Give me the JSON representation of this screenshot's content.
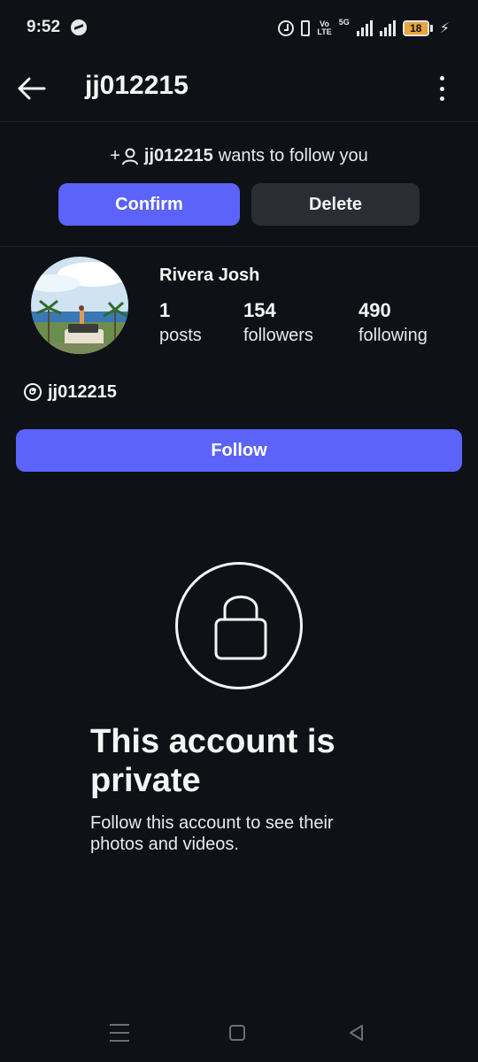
{
  "status_bar": {
    "time": "9:52",
    "network_5g": "5G",
    "volte_line1": "Vo",
    "volte_line2": "LTE",
    "battery_level": "18",
    "battery_fraction": 0.18,
    "battery_color": "#e8a53a"
  },
  "header": {
    "title": "jj012215",
    "back_icon": "arrow-left-icon",
    "menu_icon": "vertical-dots-icon"
  },
  "follow_request": {
    "icon": "add-person-icon",
    "prefix": "+",
    "username": "jj012215",
    "message": "wants to follow you",
    "confirm_label": "Confirm",
    "delete_label": "Delete"
  },
  "profile": {
    "display_name": "Rivera Josh",
    "stats": {
      "posts_count": "1",
      "posts_label": "posts",
      "followers_count": "154",
      "followers_label": "followers",
      "following_count": "490",
      "following_label": "following"
    },
    "threads_icon": "threads-icon",
    "threads_username": "jj012215",
    "follow_label": "Follow"
  },
  "private_notice": {
    "icon": "lock-icon",
    "title": "This account is private",
    "subtitle": "Follow this account to see their photos and videos."
  },
  "navigation": {
    "menu_icon": "recent-apps-icon",
    "home_icon": "home-square-icon",
    "back_icon": "back-triangle-icon"
  },
  "colors": {
    "background": "#0e1116",
    "accent": "#5b63fa",
    "secondary_button": "#2a2d33",
    "text": "#f5f5f5"
  }
}
